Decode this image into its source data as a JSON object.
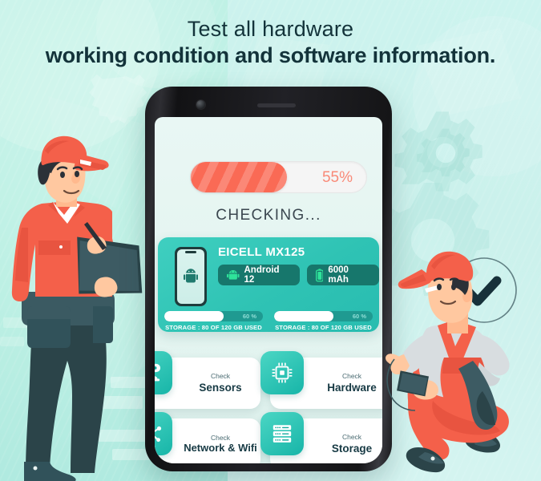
{
  "headline": {
    "line1": "Test all hardware",
    "line2": "working condition and software information."
  },
  "colors": {
    "bg_teal": "#bdf0e4",
    "accent_teal": "#2fc3b4",
    "accent_dark_teal": "#17776c",
    "progress_coral": "#fa6a55",
    "progress_text": "#f98a78",
    "text_navy": "#13333a",
    "card_white": "#ffffff",
    "uniform_orange": "#f4604a",
    "cap_red": "#f4604a"
  },
  "phone": {
    "progress": {
      "percent_label": "55%",
      "percent_value": 55
    },
    "status_text": "CHECKING...",
    "device_card": {
      "device_name": "EICELL MX125",
      "phone_icon": "android-phone-icon",
      "chips": [
        {
          "icon": "android-robot-icon",
          "label": "Android 12"
        },
        {
          "icon": "battery-icon",
          "label": "6000 mAh"
        }
      ],
      "storage_bars": [
        {
          "percent_label": "60 %",
          "percent_value": 60,
          "label": "STORAGE : 80 OF 120 GB  USED"
        },
        {
          "percent_label": "60 %",
          "percent_value": 60,
          "label": "STORAGE : 80 OF 120 GB  USED"
        }
      ]
    },
    "feature_cards": [
      {
        "icon": "sensor-icon",
        "kicker": "Check",
        "title": "Sensors"
      },
      {
        "icon": "chip-icon",
        "kicker": "Check",
        "title": "Hardware"
      },
      {
        "icon": "network-icon",
        "kicker": "Check",
        "title": "Network & Wifi"
      },
      {
        "icon": "server-icon",
        "kicker": "Check",
        "title": "Storage"
      }
    ]
  },
  "illustration": {
    "left_character": "technician-with-clipboard",
    "right_character": "technician-crouching-with-phone",
    "check_badge": "check-circle-icon",
    "background_gears": "gear-icon"
  }
}
